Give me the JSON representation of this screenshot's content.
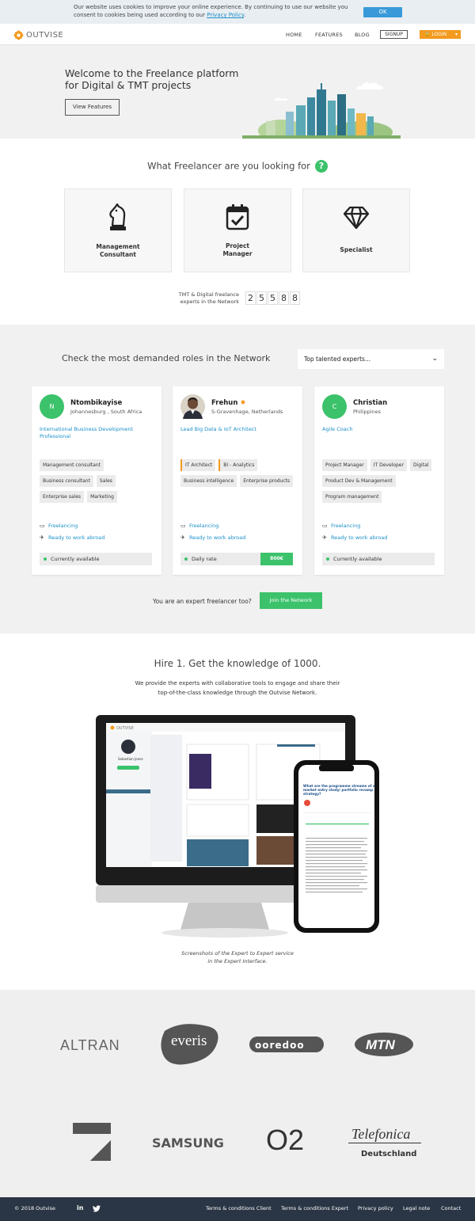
{
  "cookie": {
    "text": "Our website uses cookies to improve your online experience. By continuing to use our website you consent to cookies being used according to our ",
    "link": "Privacy Policy",
    "ok": "OK"
  },
  "nav": {
    "brand": "OUTVISE",
    "links": [
      "HOME",
      "FEATURES",
      "BLOG"
    ],
    "signup": "SIGNUP",
    "login": "LOGIN"
  },
  "hero": {
    "title_line1": "Welcome to the Freelance platform",
    "title_line2": "for Digital & TMT projects",
    "button": "View Features"
  },
  "looking": {
    "title": "What Freelancer are you looking for",
    "help": "?",
    "cards": [
      {
        "line1": "Management",
        "line2": "Consultant",
        "icon": "chess-knight-icon"
      },
      {
        "line1": "Project",
        "line2": "Manager",
        "icon": "calendar-check-icon"
      },
      {
        "line1": "Specialist",
        "line2": "",
        "icon": "diamond-icon"
      }
    ],
    "count_label_1": "TMT & Digital freelance",
    "count_label_2": "experts in the Network",
    "count_digits": [
      "2",
      "5",
      "5",
      "8",
      "8"
    ]
  },
  "roles": {
    "title": "Check the most demanded roles in the Network",
    "select_value": "Top talented experts...",
    "profiles": [
      {
        "initial": "N",
        "name": "Ntombikayise",
        "location": "Johannesburg , South Africa",
        "role": "International Business Development Professional",
        "tags": [
          "Management consultant",
          "Business consultant",
          "Sales",
          "Enterprise sales",
          "Marketing"
        ],
        "line1": "Freelancing",
        "line2": "Ready to work abroad",
        "status": "Currently available"
      },
      {
        "initial": "",
        "name": "Frehun",
        "location": "S-Gravenhage, Netherlands",
        "role": "Lead Big Data & IoT Architect",
        "tags": [
          "IT Architect",
          "BI - Analytics",
          "Business intelligence",
          "Enterprise products"
        ],
        "line1": "Freelancing",
        "line2": "Ready to work abroad",
        "status": "Daily rate",
        "rate": "800€"
      },
      {
        "initial": "C",
        "name": "Christian",
        "location": "Philippines",
        "role": "Agile Coach",
        "tags": [
          "Project Manager",
          "IT Developer",
          "Digital",
          "Product Dev & Management",
          "Program management"
        ],
        "line1": "Freelancing",
        "line2": "Ready to work abroad",
        "status": "Currently available"
      }
    ],
    "expert_question": "You are an expert freelancer too?",
    "join": "Join the Network"
  },
  "hire": {
    "title": "Hire 1. Get the knowledge of 1000.",
    "sub_line1": "We provide the experts with collaborative tools to engage and share their",
    "sub_line2": "top-of-the-class knowledge through the Outvise Network.",
    "caption_line1": "Screenshots of the Expert to Expert service",
    "caption_line2": "in the Expert Interface.",
    "screen_name": "Sebastian Jones",
    "phone_question": "What are the programme streams of a market entry study/ portfolio reassignment strategy?"
  },
  "logos": [
    "ALTRAN",
    "everis",
    "ooredoo",
    "MTN",
    "ProSieben",
    "SAMSUNG",
    "O2",
    "Telefonica",
    "Deutschland"
  ],
  "footer": {
    "copyright": "© 2018 Outvise",
    "social": [
      "in",
      "twitter"
    ],
    "links": [
      "Terms & conditions Client",
      "Terms & conditions Expert",
      "Privacy policy",
      "Legal note",
      "Contact"
    ]
  },
  "colors": {
    "accent_green": "#3cc26b",
    "accent_orange": "#f39a1f",
    "link_blue": "#1b8fc9",
    "footer_bg": "#2a3545"
  }
}
